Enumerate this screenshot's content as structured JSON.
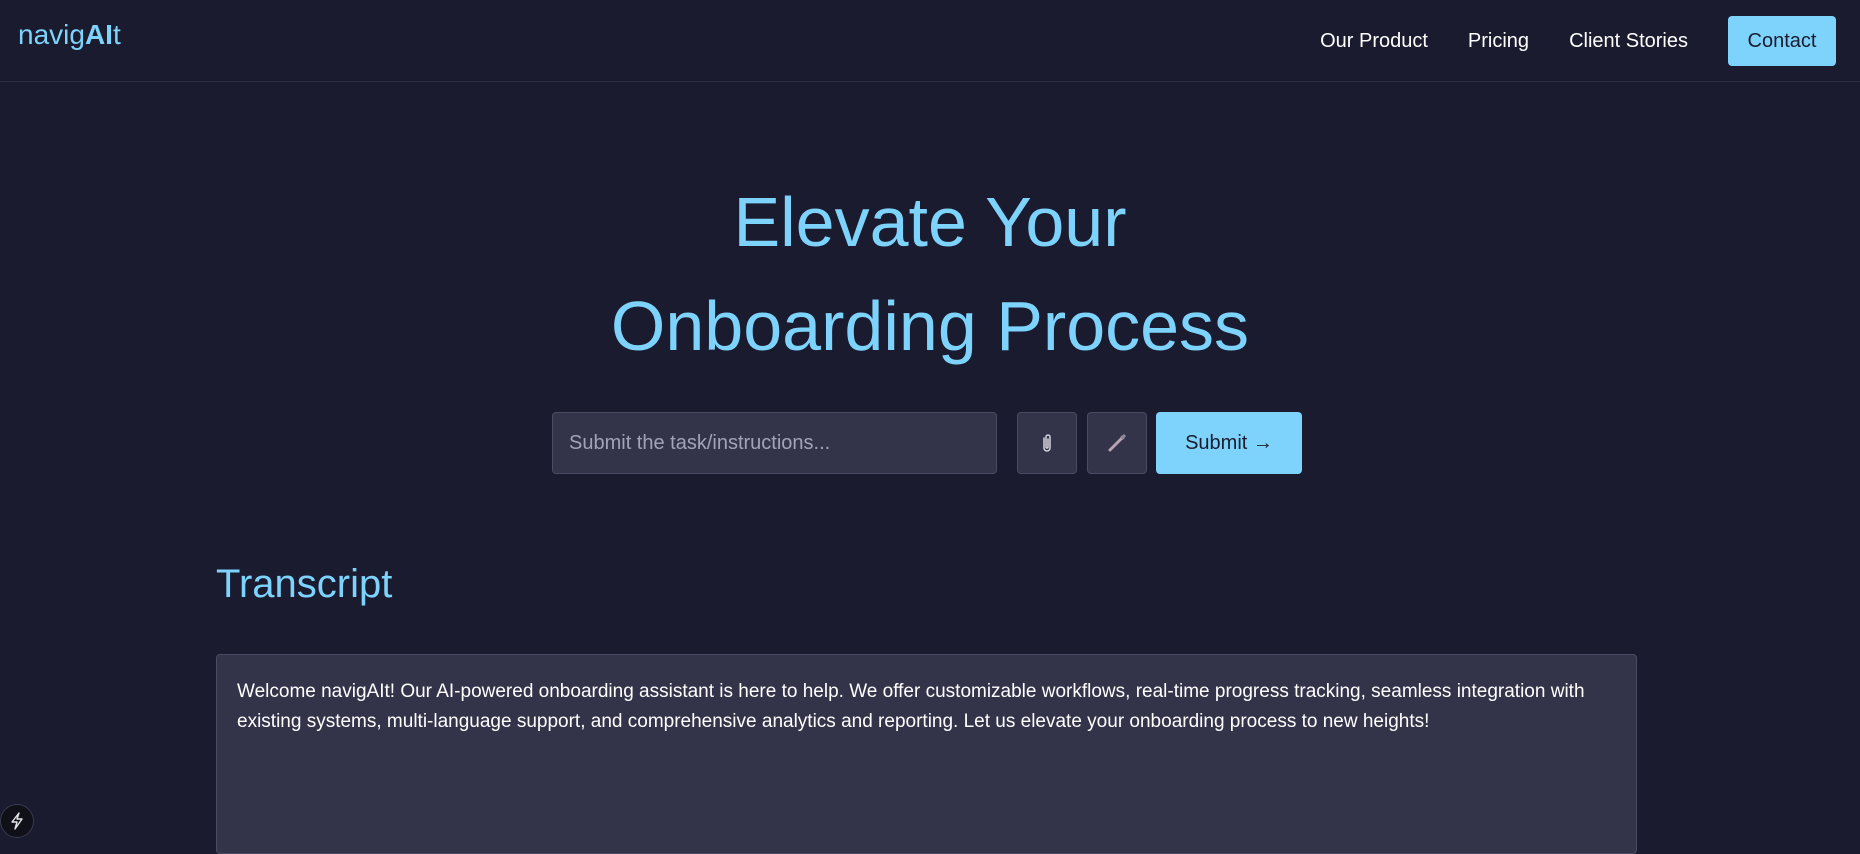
{
  "header": {
    "logo_prefix": "navig",
    "logo_bold": "AI",
    "logo_suffix": "t",
    "nav": [
      "Our Product",
      "Pricing",
      "Client Stories"
    ],
    "contact_label": "Contact"
  },
  "hero": {
    "title_line1": "Elevate Your",
    "title_line2": "Onboarding Process"
  },
  "task": {
    "placeholder": "Submit the task/instructions...",
    "value": "",
    "attach_icon": "paperclip-icon",
    "pencil_icon": "pencil-icon",
    "submit_label": "Submit →"
  },
  "transcript": {
    "title": "Transcript",
    "text": "Welcome navigAIt! Our AI-powered onboarding assistant is here to help. We offer customizable workflows, real-time progress tracking, seamless integration with existing systems, multi-language support, and comprehensive analytics and reporting. Let us elevate your onboarding process to new heights!"
  },
  "floating": {
    "bolt_icon": "lightning-bolt-icon"
  },
  "colors": {
    "background": "#1a1b2e",
    "accent": "#7dd3fc",
    "panel": "#33334a",
    "border": "#4a4a62"
  }
}
